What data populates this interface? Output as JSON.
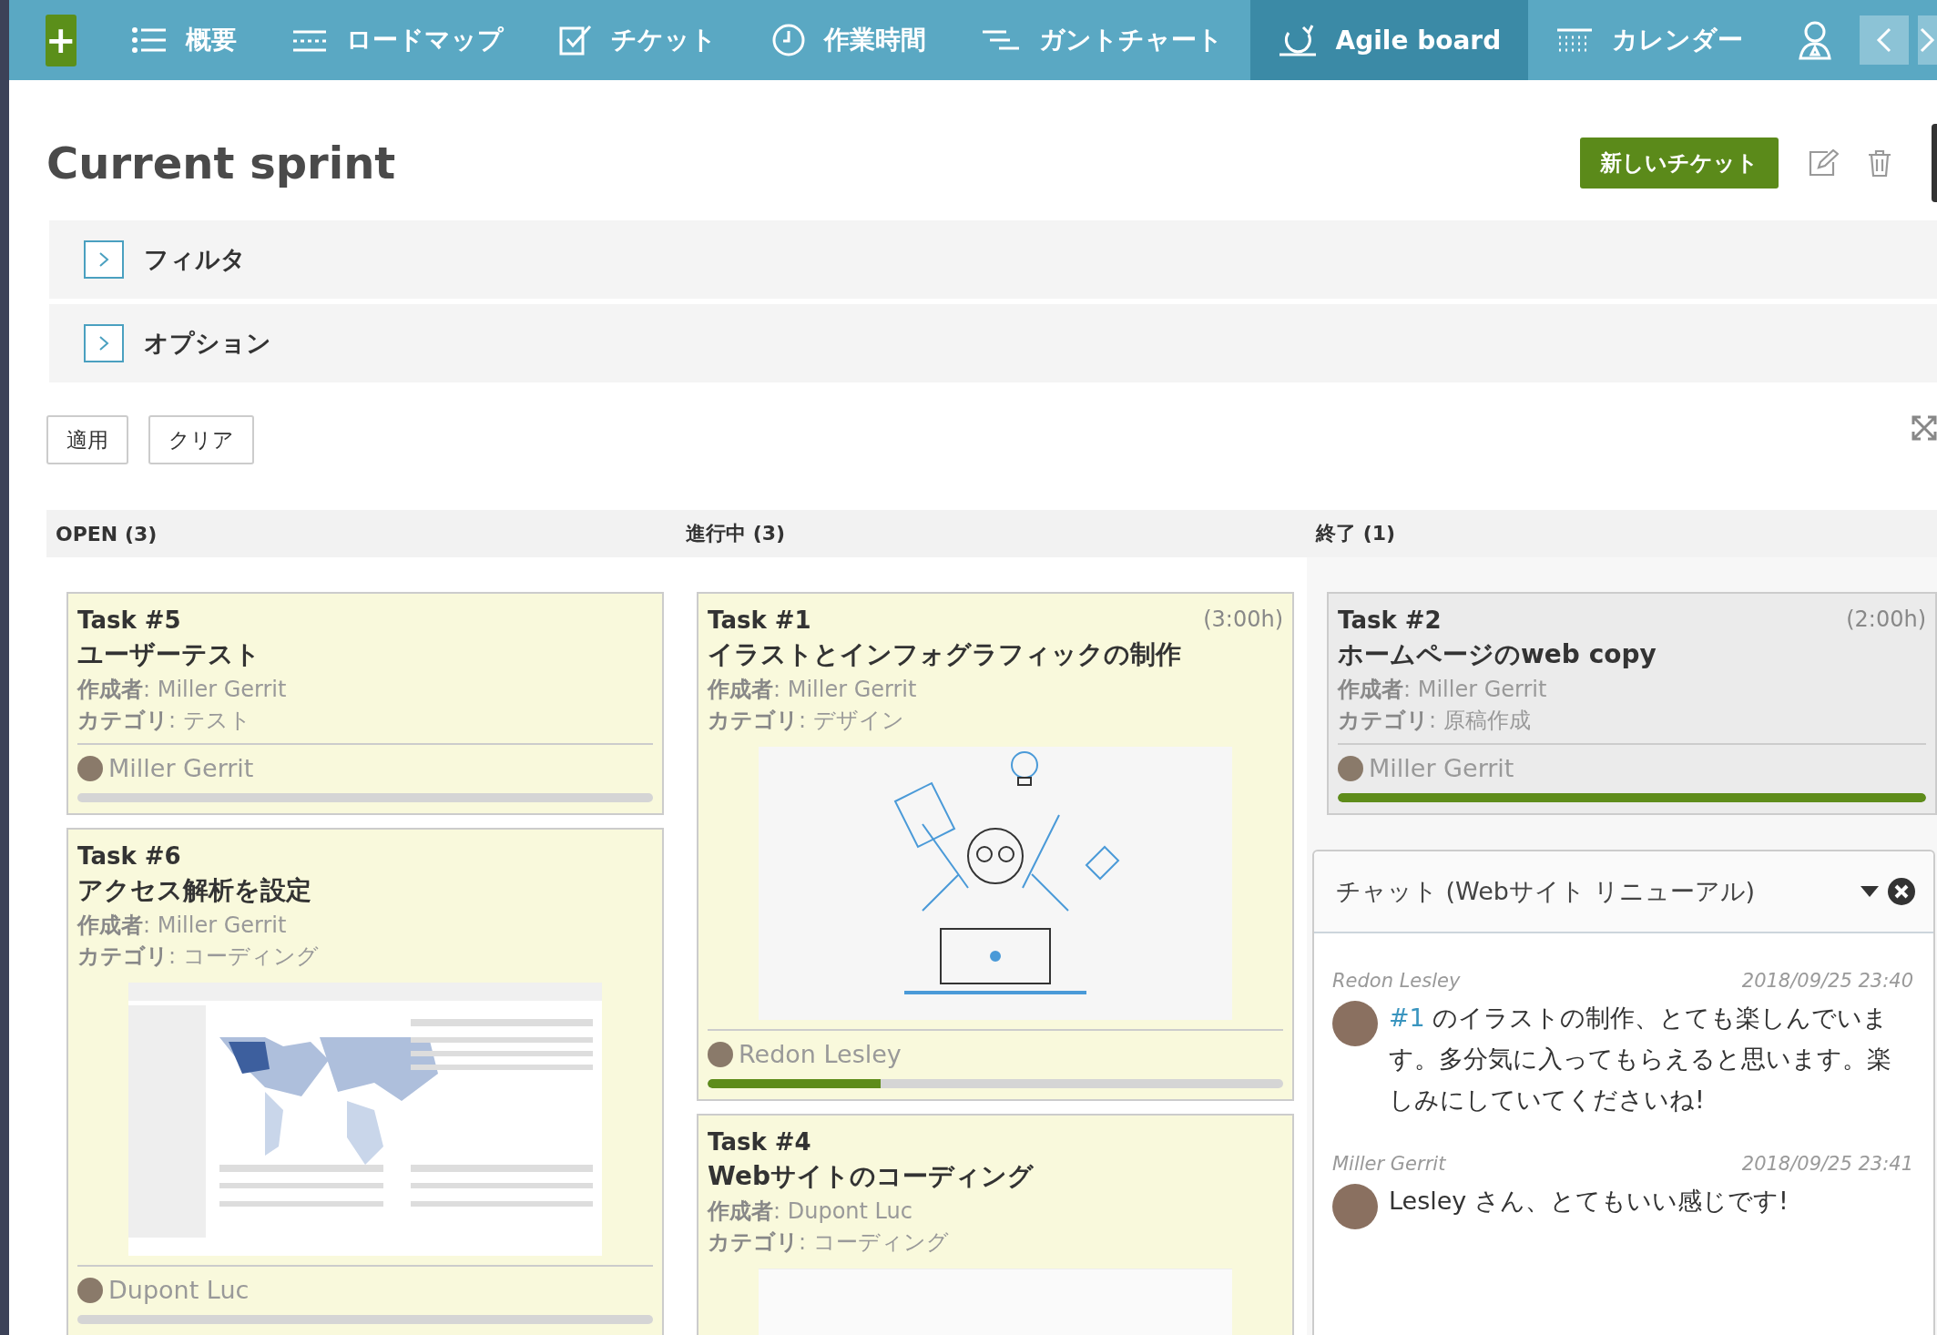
{
  "nav": {
    "add_label": "+",
    "items": [
      {
        "label": "概要",
        "selected": false
      },
      {
        "label": "ロードマップ",
        "selected": false
      },
      {
        "label": "チケット",
        "selected": false
      },
      {
        "label": "作業時間",
        "selected": false
      },
      {
        "label": "ガントチャート",
        "selected": false
      },
      {
        "label": "Agile board",
        "selected": true
      },
      {
        "label": "カレンダー",
        "selected": false
      },
      {
        "selected": false
      }
    ]
  },
  "header": {
    "title": "Current sprint",
    "new_button": "新しいチケット"
  },
  "panels": [
    {
      "label": "フィルタ",
      "expanded": false
    },
    {
      "label": "オプション",
      "expanded": false
    }
  ],
  "actions": [
    "適用",
    "クリア"
  ],
  "columns": [
    {
      "title": "OPEN (3)",
      "cards": [
        {
          "task": "Task #5",
          "title": "ユーザーテスト",
          "author": "**作成者**: Miller Gerrit",
          "category": "**カテゴリ**: テスト",
          "closed": false,
          "kind": "plain",
          "assignee": "Miller Gerrit",
          "level": 0
        },
        {
          "task": "Task #6",
          "title": "アクセス解析を設定",
          "author": "**作成者**: Miller Gerrit",
          "category": "**カテゴリ**: コーディング",
          "closed": false,
          "kind": "screenshot",
          "assignee": "Dupont Luc",
          "level": 0
        }
      ]
    },
    {
      "title": "進行中 (3)",
      "cards": [
        {
          "task": "Task #1",
          "hours": "(3:00h)",
          "title": "イラストとインフォグラフィックの制作",
          "author": "**作成者**: Miller Gerrit",
          "category": "**カテゴリ**: デザイン",
          "closed": false,
          "kind": "illustration",
          "assignee": "Redon Lesley",
          "level": 0.3
        },
        {
          "task": "Task #4",
          "title": "Webサイトのコーディング",
          "author": "**作成者**: Dupont Luc",
          "category": "**カテゴリ**: コーディング",
          "closed": false,
          "kind": "webpage"
        }
      ]
    },
    {
      "title": "終了 (1)",
      "cards": [
        {
          "task": "Task #2",
          "hours": "(2:00h)",
          "title": "ホームページのweb copy",
          "author": "**作成者**: Miller Gerrit",
          "category": "**カテゴリ**: 原稿作成",
          "closed": true,
          "kind": "plain",
          "assignee": "Miller Gerrit",
          "level": 1
        }
      ]
    }
  ],
  "chat": {
    "title": "チャット (Webサイト リニューアル)",
    "messages": [
      {
        "author": "Redon Lesley",
        "time": "2018/09/25 23:40",
        "link": "#1",
        "text": "のイラストの制作、とても楽しんでいます。多分気に入ってもらえると思います。楽しみにしていてくださいね!"
      },
      {
        "author": "Miller Gerrit",
        "time": "2018/09/25 23:41",
        "text": "Lesley さん、とてもいい感じです!"
      }
    ]
  }
}
